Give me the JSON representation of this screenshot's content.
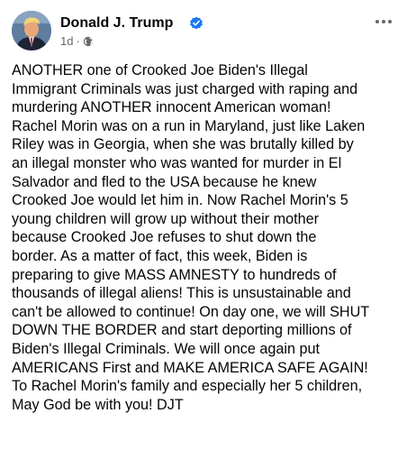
{
  "post": {
    "author": "Donald J. Trump",
    "time": "1d",
    "separator": "·",
    "verified_icon": "verified-badge-icon",
    "privacy_icon": "globe-icon",
    "menu_icon": "more-options-icon",
    "accent_color": "#1877f2",
    "body_lines": [
      "ANOTHER one of Crooked Joe Biden's Illegal",
      "Immigrant Criminals was just charged with raping and",
      "murdering ANOTHER innocent American woman!",
      "Rachel Morin was on a run in Maryland, just like Laken",
      "Riley was in Georgia, when she was brutally killed by",
      "an illegal monster who was wanted for murder in El",
      "Salvador and fled to the USA because he knew",
      "Crooked Joe would let him in. Now Rachel Morin's 5",
      "young children will grow up without their mother",
      "because Crooked Joe refuses to shut down the",
      "border. As a matter of fact, this week, Biden is",
      "preparing to give MASS AMNESTY to hundreds of",
      "thousands of illegal aliens! This is unsustainable and",
      "can't be allowed to continue! On day one, we will SHUT",
      "DOWN THE BORDER and start deporting millions of",
      "Biden's Illegal Criminals. We will once again put",
      "AMERICANS First and MAKE AMERICA SAFE AGAIN!",
      "To Rachel Morin's family and especially her 5 children,",
      "May God be with you! DJT"
    ]
  }
}
